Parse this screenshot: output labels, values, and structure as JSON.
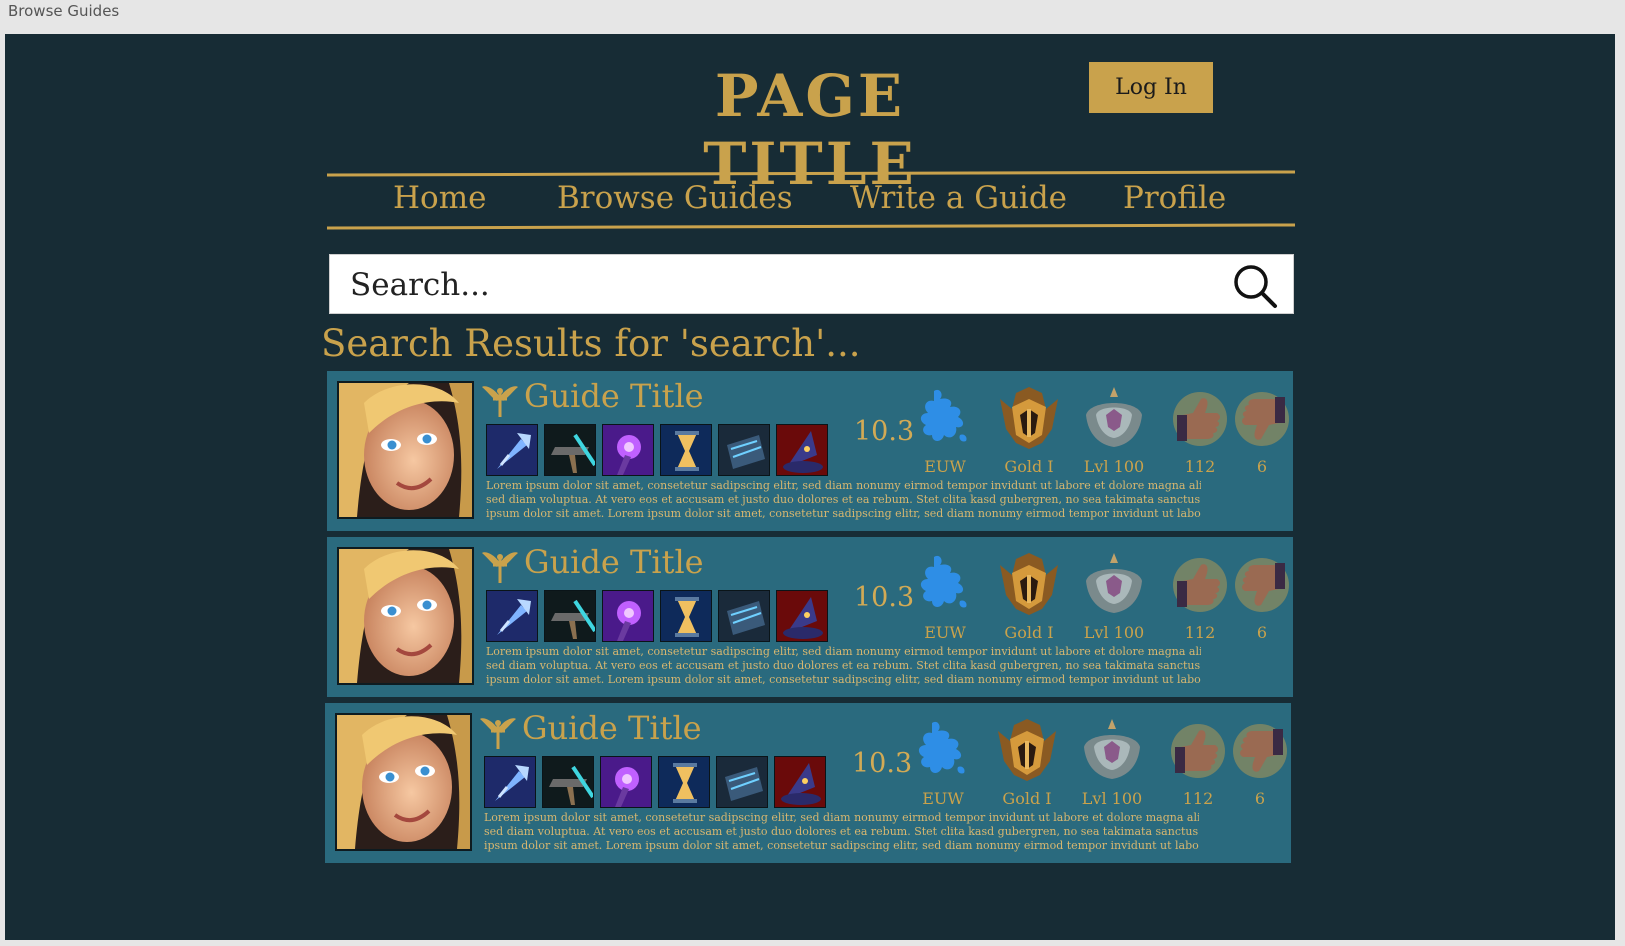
{
  "window": {
    "title": "Browse Guides"
  },
  "header": {
    "page_title": "PAGE TITLE",
    "login_label": "Log In"
  },
  "nav": {
    "items": [
      "Home",
      "Browse Guides",
      "Write a Guide",
      "Profile"
    ]
  },
  "search": {
    "placeholder": "Search..."
  },
  "results": {
    "heading": "Search Results for 'search'...",
    "cards": [
      {
        "title": "Guide Title",
        "patch": "10.3",
        "region": "EUW",
        "rank": "Gold I",
        "level": "Lvl 100",
        "likes": "112",
        "dislikes": "6",
        "items": [
          "crystal-scepter-icon",
          "hammer-icon",
          "arcane-staff-icon",
          "hourglass-icon",
          "tome-icon",
          "wizard-hat-icon"
        ],
        "desc_lines": [
          "Lorem ipsum dolor sit amet, consetetur sadipscing elitr, sed diam nonumy eirmod tempor invidunt ut labore et dolore magna aliquyam erat,",
          "sed diam voluptua. At vero eos et accusam et justo duo dolores et ea rebum. Stet clita kasd gubergren, no sea takimata sanctus est Lorem",
          "ipsum dolor sit amet. Lorem ipsum dolor sit amet, consetetur sadipscing elitr, sed diam nonumy eirmod tempor invidunt ut labore et dolore"
        ]
      },
      {
        "title": "Guide Title",
        "patch": "10.3",
        "region": "EUW",
        "rank": "Gold I",
        "level": "Lvl 100",
        "likes": "112",
        "dislikes": "6",
        "items": [
          "crystal-scepter-icon",
          "hammer-icon",
          "arcane-staff-icon",
          "hourglass-icon",
          "tome-icon",
          "wizard-hat-icon"
        ],
        "desc_lines": [
          "Lorem ipsum dolor sit amet, consetetur sadipscing elitr, sed diam nonumy eirmod tempor invidunt ut labore et dolore magna aliquyam erat,",
          "sed diam voluptua. At vero eos et accusam et justo duo dolores et ea rebum. Stet clita kasd gubergren, no sea takimata sanctus est Lorem",
          "ipsum dolor sit amet. Lorem ipsum dolor sit amet, consetetur sadipscing elitr, sed diam nonumy eirmod tempor invidunt ut labore et dolore"
        ]
      },
      {
        "title": "Guide Title",
        "patch": "10.3",
        "region": "EUW",
        "rank": "Gold I",
        "level": "Lvl 100",
        "likes": "112",
        "dislikes": "6",
        "items": [
          "crystal-scepter-icon",
          "hammer-icon",
          "arcane-staff-icon",
          "hourglass-icon",
          "tome-icon",
          "wizard-hat-icon"
        ],
        "desc_lines": [
          "Lorem ipsum dolor sit amet, consetetur sadipscing elitr, sed diam nonumy eirmod tempor invidunt ut labore et dolore magna aliquyam erat,",
          "sed diam voluptua. At vero eos et accusam et justo duo dolores et ea rebum. Stet clita kasd gubergren, no sea takimata sanctus est Lorem",
          "ipsum dolor sit amet. Lorem ipsum dolor sit amet, consetetur sadipscing elitr, sed diam nonumy eirmod tempor invidunt ut labore et dolore"
        ]
      }
    ]
  },
  "colors": {
    "background": "#172c35",
    "card": "#2a6a7e",
    "gold": "#c9a24c"
  }
}
